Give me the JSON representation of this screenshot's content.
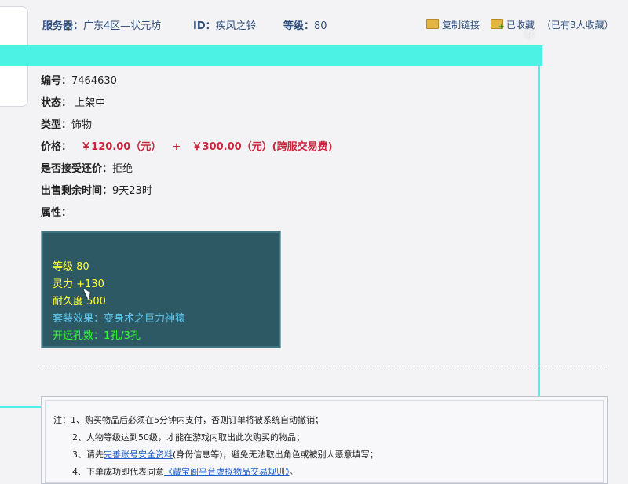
{
  "header": {
    "server_label": "服务器：",
    "server_value": "广东4区—状元坊",
    "id_label": "ID：",
    "id_value": "疾风之铃",
    "level_label": "等级：",
    "level_value": "80",
    "copy_link": "复制链接",
    "favorited": "已收藏",
    "favorite_count": "（已有3人收藏）"
  },
  "item": {
    "id_label": "编号：",
    "id_value": "7464630",
    "status_label": "状态：",
    "status_value": "上架中",
    "type_label": "类型：",
    "type_value": "饰物",
    "price_label": "价格：",
    "price_value": "￥120.00（元）",
    "price_plus": "+",
    "fee_value": "￥300.00（元）(跨服交易费)",
    "bargain_label": "是否接受还价：",
    "bargain_value": "拒绝",
    "time_label": "出售剩余时间：",
    "time_value": "9天23时",
    "attr_label": "属性："
  },
  "attributes": {
    "level": "等级 80",
    "spirit": "灵力 +130",
    "durability": "耐久度 500",
    "set_effect": "套装效果：变身术之巨力神猿",
    "holes": "开运孔数：1孔/3孔"
  },
  "notes": {
    "line1": "注：1、购买物品后必须在5分钟内支付，否则订单将被系统自动撤销；",
    "line2": "2、人物等级达到50级，才能在游戏内取出此次购买的物品；",
    "line3_pre": "3、请先",
    "line3_link": "完善账号安全资料",
    "line3_post": "(身份信息等)，避免无法取出角色或被别人恶意填写；",
    "line4_pre": "4、下单成功即代表同意",
    "line4_link": "《藏宝阁平台虚拟物品交易规则》",
    "line4_post": "。"
  },
  "colors": {
    "accent_highlight": "#4cf2e4",
    "header_text": "#2d4e7d",
    "price_red": "#c8263e",
    "attr_panel_bg": "#2d5964"
  }
}
